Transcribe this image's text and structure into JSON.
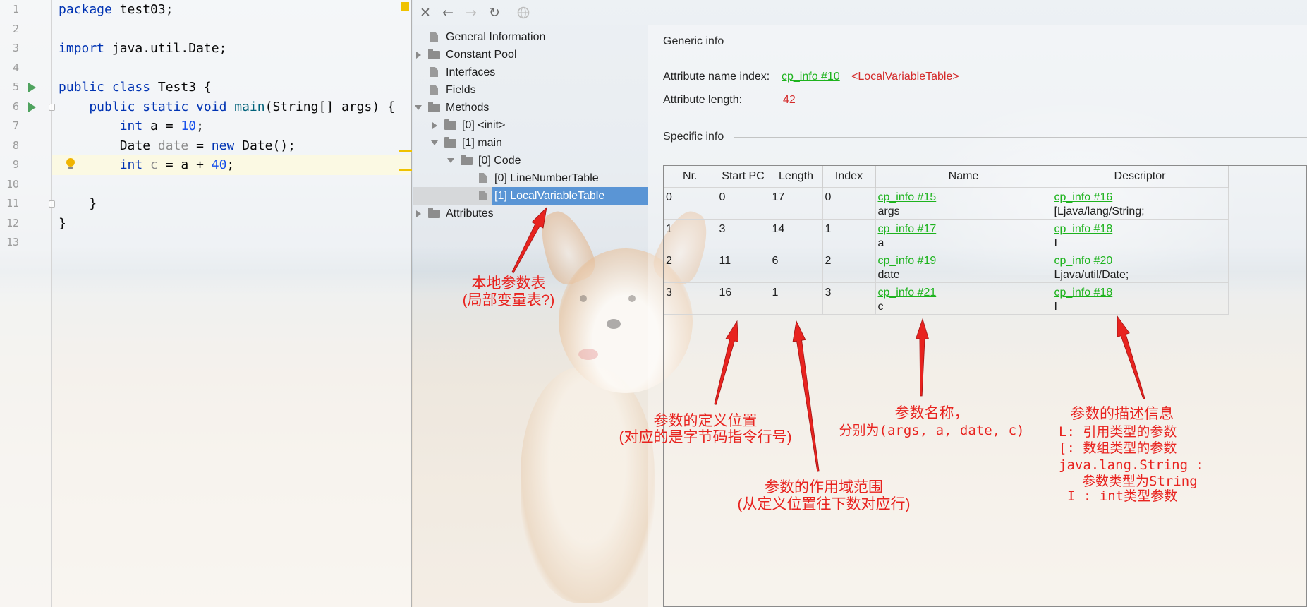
{
  "colors": {
    "keyword": "#0033b3",
    "number": "#1750eb",
    "method": "#00627a",
    "unused": "#8c8c8c",
    "plain": "#080808",
    "link": "#1db31d",
    "attr_value": "#d42a2a",
    "annotation": "#e8231f",
    "selection": "#5a95d5",
    "run_icon": "#4fa35f"
  },
  "editor": {
    "line_numbers": [
      "1",
      "2",
      "3",
      "4",
      "5",
      "6",
      "7",
      "8",
      "9",
      "10",
      "11",
      "12",
      "13"
    ],
    "lines": [
      [
        {
          "text": "package",
          "kind": "keyword"
        },
        {
          "text": " test03;",
          "kind": "plain"
        }
      ],
      [],
      [
        {
          "text": "import",
          "kind": "keyword"
        },
        {
          "text": " java.util.Date;",
          "kind": "plain"
        }
      ],
      [],
      [
        {
          "text": "public class",
          "kind": "keyword"
        },
        {
          "text": " Test3 {",
          "kind": "plain"
        }
      ],
      [
        {
          "text": "    public static void ",
          "kind": "keyword"
        },
        {
          "text": "main",
          "kind": "method"
        },
        {
          "text": "(String[] args) {",
          "kind": "plain"
        }
      ],
      [
        {
          "text": "        int ",
          "kind": "keyword"
        },
        {
          "text": "a = ",
          "kind": "plain"
        },
        {
          "text": "10",
          "kind": "number"
        },
        {
          "text": ";",
          "kind": "plain"
        }
      ],
      [
        {
          "text": "        Date ",
          "kind": "plain"
        },
        {
          "text": "date",
          "kind": "unused"
        },
        {
          "text": " = ",
          "kind": "plain"
        },
        {
          "text": "new",
          "kind": "keyword"
        },
        {
          "text": " Date();",
          "kind": "plain"
        }
      ],
      [
        {
          "text": "        int ",
          "kind": "keyword"
        },
        {
          "text": "c",
          "kind": "unused"
        },
        {
          "text": " = a + ",
          "kind": "plain"
        },
        {
          "text": "40",
          "kind": "number"
        },
        {
          "text": ";",
          "kind": "plain"
        }
      ],
      [],
      [
        {
          "text": "    }",
          "kind": "plain"
        }
      ],
      [
        {
          "text": "}",
          "kind": "plain"
        }
      ],
      []
    ],
    "gutter_icons": [
      "run-icon",
      "run-icon",
      "lightbulb-icon",
      "fold-icon"
    ]
  },
  "toolbar": {
    "buttons": [
      {
        "icon": "close-icon",
        "enabled": true
      },
      {
        "icon": "back-icon",
        "enabled": true
      },
      {
        "icon": "forward-icon",
        "enabled": false
      },
      {
        "icon": "refresh-icon",
        "enabled": true
      },
      {
        "icon": "browser-icon",
        "enabled": false
      }
    ]
  },
  "tree": {
    "items": [
      {
        "label": "General Information",
        "level": 0,
        "state": "leaf",
        "icon": "file-icon"
      },
      {
        "label": "Constant Pool",
        "level": 0,
        "state": "collapsed",
        "icon": "folder-icon"
      },
      {
        "label": "Interfaces",
        "level": 0,
        "state": "leaf",
        "icon": "file-icon"
      },
      {
        "label": "Fields",
        "level": 0,
        "state": "leaf",
        "icon": "file-icon"
      },
      {
        "label": "Methods",
        "level": 0,
        "state": "expanded",
        "icon": "folder-icon"
      },
      {
        "label": "[0] <init>",
        "level": 1,
        "state": "collapsed",
        "icon": "folder-icon"
      },
      {
        "label": "[1] main",
        "level": 1,
        "state": "expanded",
        "icon": "folder-icon"
      },
      {
        "label": "[0] Code",
        "level": 2,
        "state": "expanded",
        "icon": "folder-icon"
      },
      {
        "label": "[0] LineNumberTable",
        "level": 3,
        "state": "leaf",
        "icon": "file-icon"
      },
      {
        "label": "[1] LocalVariableTable",
        "level": 3,
        "state": "leaf",
        "icon": "file-icon",
        "selected": true
      },
      {
        "label": "Attributes",
        "level": 0,
        "state": "collapsed",
        "icon": "folder-icon"
      }
    ]
  },
  "generic_info": {
    "title": "Generic info",
    "name_index_label": "Attribute name index:",
    "name_index_link": "cp_info #10",
    "name_index_value": "<LocalVariableTable>",
    "length_label": "Attribute length:",
    "length_value": "42"
  },
  "specific_info": {
    "title": "Specific info",
    "columns": [
      "Nr.",
      "Start PC",
      "Length",
      "Index",
      "Name",
      "Descriptor"
    ],
    "rows": [
      {
        "nr": "0",
        "start_pc": "0",
        "length": "17",
        "index": "0",
        "name_ref": "cp_info #15",
        "name": "args",
        "descriptor_ref": "cp_info #16",
        "descriptor": "[Ljava/lang/String;"
      },
      {
        "nr": "1",
        "start_pc": "3",
        "length": "14",
        "index": "1",
        "name_ref": "cp_info #17",
        "name": "a",
        "descriptor_ref": "cp_info #18",
        "descriptor": "I"
      },
      {
        "nr": "2",
        "start_pc": "11",
        "length": "6",
        "index": "2",
        "name_ref": "cp_info #19",
        "name": "date",
        "descriptor_ref": "cp_info #20",
        "descriptor": "Ljava/util/Date;"
      },
      {
        "nr": "3",
        "start_pc": "16",
        "length": "1",
        "index": "3",
        "name_ref": "cp_info #21",
        "name": "c",
        "descriptor_ref": "cp_info #18",
        "descriptor": "I"
      }
    ]
  },
  "annotations": {
    "local_table": [
      "本地参数表",
      "(局部变量表?)"
    ],
    "start_pc": [
      "参数的定义位置",
      "(对应的是字节码指令行号)"
    ],
    "length": [
      "参数的作用域范围",
      "(从定义位置往下数对应行)"
    ],
    "name": [
      "参数名称，",
      "分别为(args, a, date, c)"
    ],
    "descriptor": [
      "参数的描述信息",
      "L: 引用类型的参数",
      "[: 数组类型的参数",
      "java.lang.String :",
      "参数类型为String",
      "I : int类型参数"
    ]
  }
}
